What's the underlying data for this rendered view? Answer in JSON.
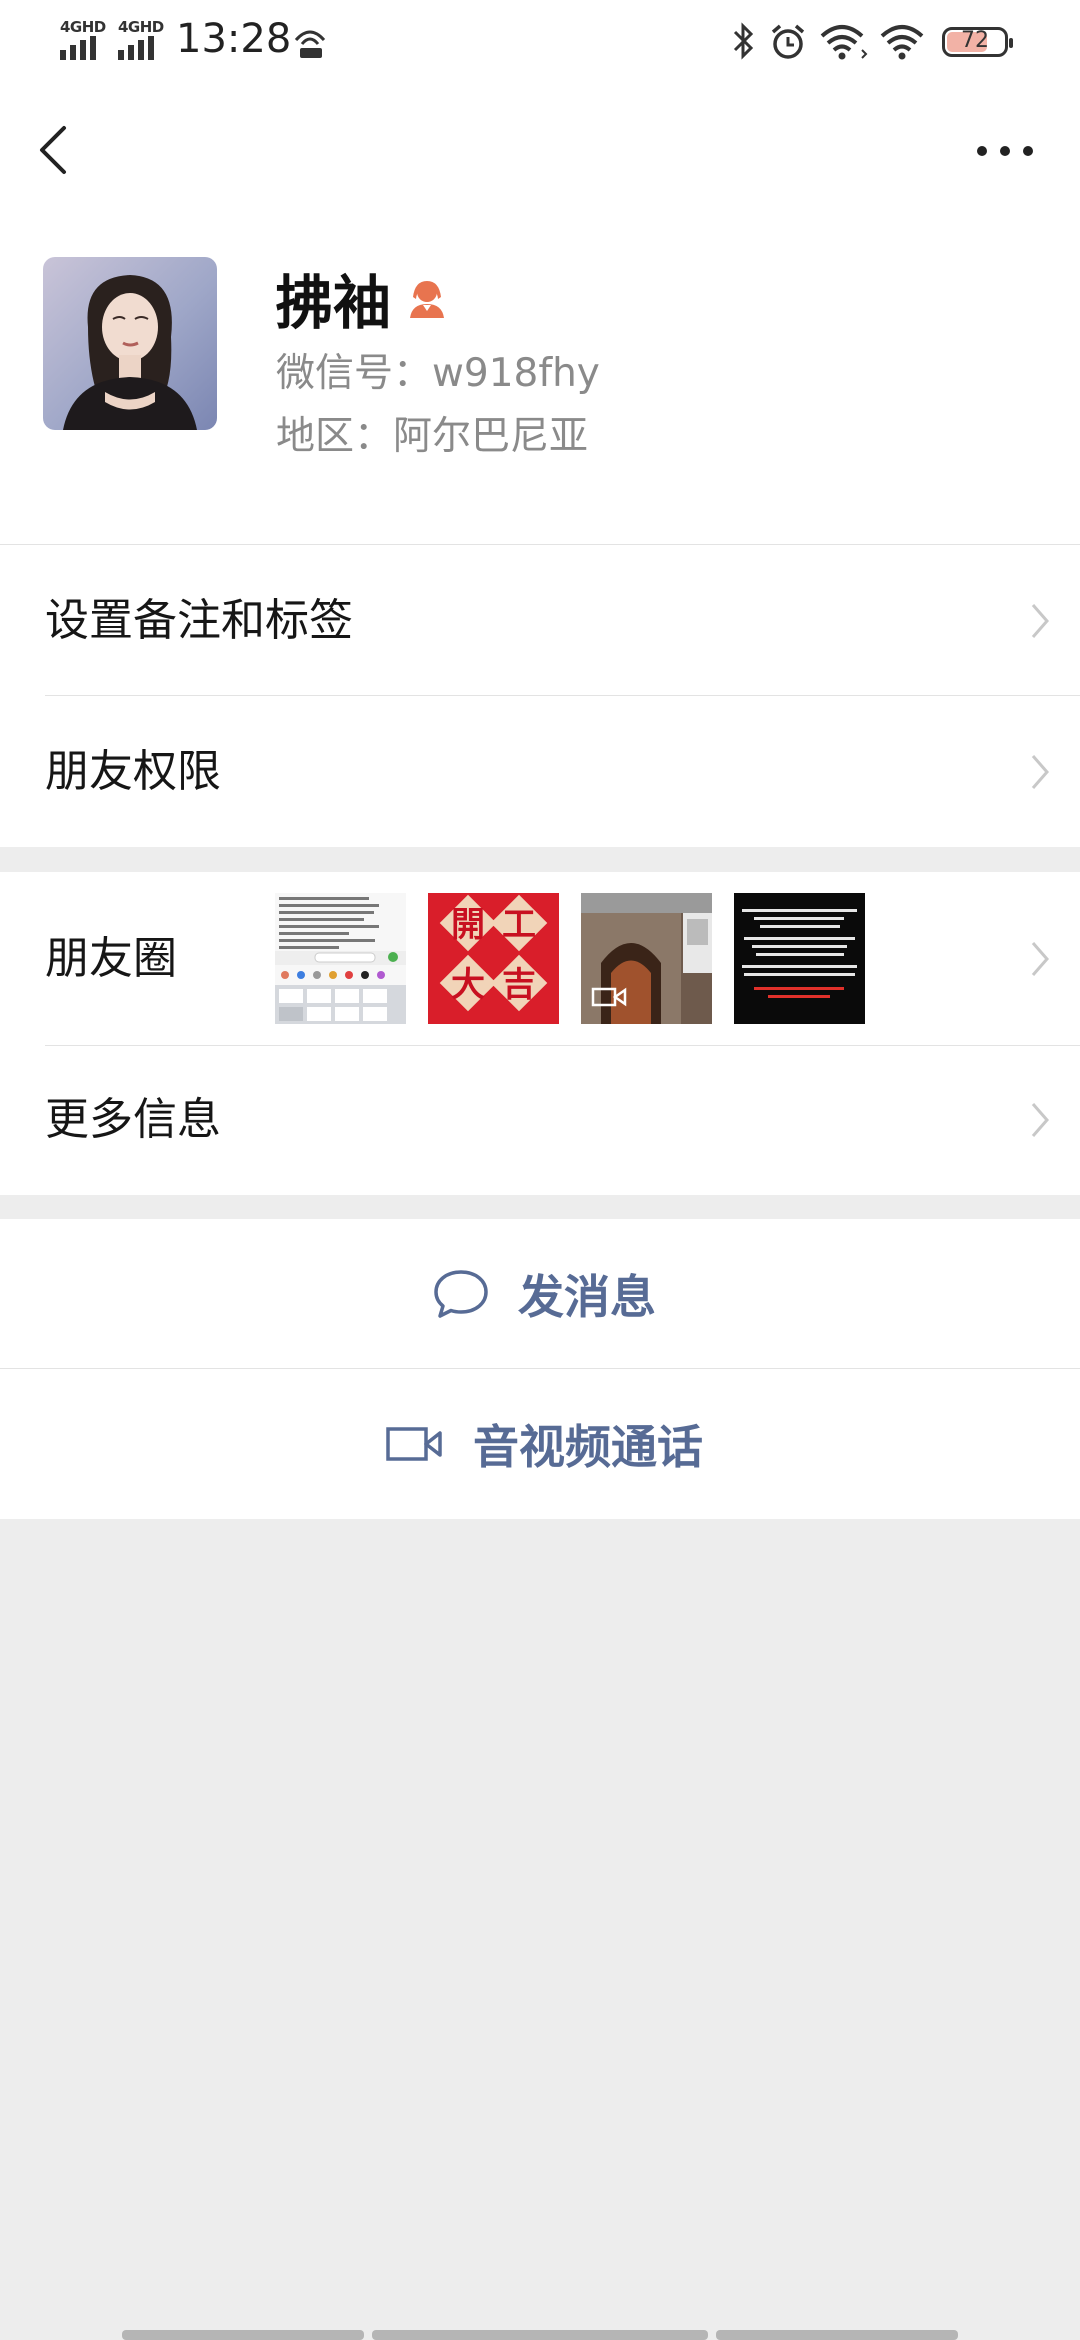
{
  "status_bar": {
    "signal1": "4GHD",
    "signal2": "4GHD",
    "time": "13:28",
    "battery": "72",
    "battery_fraction": 0.72
  },
  "nav": {
    "back_icon": "chevron-left-icon",
    "more_icon": "ellipsis-icon"
  },
  "profile": {
    "name": "拂袖",
    "wechat_id": "微信号：w918fhy",
    "region": "地区：阿尔巴尼亚",
    "gender_icon": "female-user-icon",
    "accent_color": "#e8744f"
  },
  "menu": {
    "remark_tags": "设置备注和标签",
    "friend_permissions": "朋友权限",
    "moments": "朋友圈",
    "more_info": "更多信息"
  },
  "moments_thumbs": {
    "thumb2_text1": "開",
    "thumb2_text2": "工",
    "thumb2_text3": "大",
    "thumb2_text4": "吉"
  },
  "actions": {
    "send_message": "发消息",
    "av_call": "音视频通话",
    "action_color": "#576b95"
  },
  "colors": {
    "background": "#ededed",
    "card": "#ffffff"
  }
}
